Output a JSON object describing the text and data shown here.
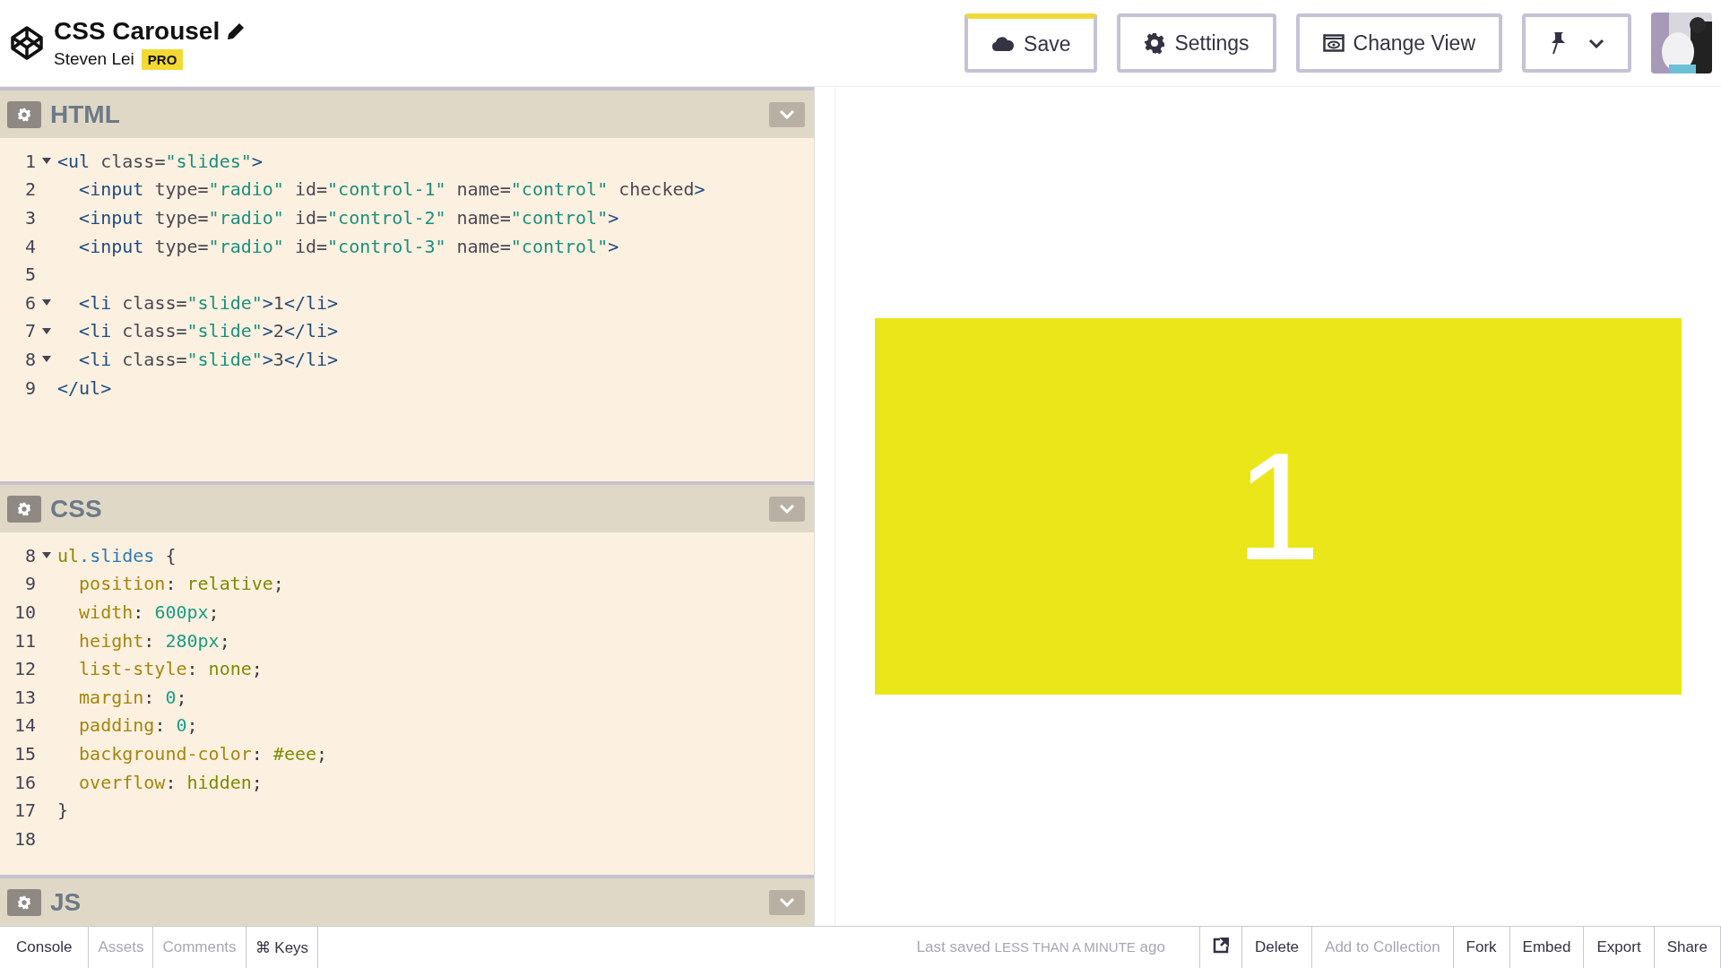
{
  "header": {
    "title": "CSS Carousel",
    "author": "Steven Lei",
    "badge": "PRO"
  },
  "toolbar": [
    {
      "kind": "text",
      "label": "Save",
      "accent": true
    },
    {
      "kind": "text",
      "label": "Settings",
      "accent": false
    },
    {
      "kind": "text",
      "label": "Change View",
      "accent": false
    },
    {
      "kind": "menu",
      "accent": false
    }
  ],
  "panels": [
    {
      "title": "HTML",
      "kind": "html",
      "lines": [
        {
          "num": "1",
          "foldable": true,
          "text": "<ul class=\"slides\">"
        },
        {
          "num": "2",
          "foldable": false,
          "text": "  <input type=\"radio\" id=\"control-1\" name=\"control\" checked>"
        },
        {
          "num": "3",
          "foldable": false,
          "text": "  <input type=\"radio\" id=\"control-2\" name=\"control\">"
        },
        {
          "num": "4",
          "foldable": false,
          "text": "  <input type=\"radio\" id=\"control-3\" name=\"control\">"
        },
        {
          "num": "5",
          "foldable": false
        },
        {
          "num": "6",
          "foldable": true,
          "text": "  <li class=\"slide\">1</li>"
        },
        {
          "num": "7",
          "foldable": true,
          "text": "  <li class=\"slide\">2</li>"
        },
        {
          "num": "8",
          "foldable": true,
          "text": "  <li class=\"slide\">3</li>"
        },
        {
          "num": "9",
          "foldable": false,
          "text": "</ul>"
        }
      ]
    },
    {
      "title": "CSS",
      "kind": "css",
      "lines": [
        {
          "num": "8",
          "foldable": true,
          "text": "ul.slides {"
        },
        {
          "num": "9",
          "foldable": false,
          "text": "  position: relative;"
        },
        {
          "num": "10",
          "foldable": false,
          "text": "  width: 600px;"
        },
        {
          "num": "11",
          "foldable": false,
          "text": "  height: 280px;"
        },
        {
          "num": "12",
          "foldable": false,
          "text": "  list-style: none;"
        },
        {
          "num": "13",
          "foldable": false,
          "text": "  margin: 0;"
        },
        {
          "num": "14",
          "foldable": false,
          "text": "  padding: 0;"
        },
        {
          "num": "15",
          "foldable": false,
          "text": "  background-color: #eee;"
        },
        {
          "num": "16",
          "foldable": false,
          "text": "  overflow: hidden;"
        },
        {
          "num": "17",
          "foldable": false,
          "text": "}"
        },
        {
          "num": "18",
          "foldable": false
        }
      ]
    },
    {
      "title": "JS"
    }
  ],
  "preview": {
    "slide": "1"
  },
  "footer": {
    "left": [
      {
        "label": "Console",
        "disabled": false
      },
      {
        "label": "Assets",
        "disabled": true
      },
      {
        "label": "Comments",
        "disabled": true
      },
      {
        "label": "⌘ Keys",
        "disabled": false
      }
    ],
    "status": {
      "prefix": "Last saved",
      "emphasis": "LESS THAN A MINUTE",
      "suffix": "ago"
    },
    "right": [
      {
        "kind": "icon",
        "disabled": false
      },
      {
        "kind": "text",
        "label": "Delete",
        "disabled": false
      },
      {
        "kind": "text",
        "label": "Add to Collection",
        "disabled": true
      },
      {
        "kind": "text",
        "label": "Fork",
        "disabled": false
      },
      {
        "kind": "text",
        "label": "Embed",
        "disabled": false
      },
      {
        "kind": "text",
        "label": "Export",
        "disabled": false
      },
      {
        "kind": "text",
        "label": "Share",
        "disabled": false
      }
    ]
  }
}
